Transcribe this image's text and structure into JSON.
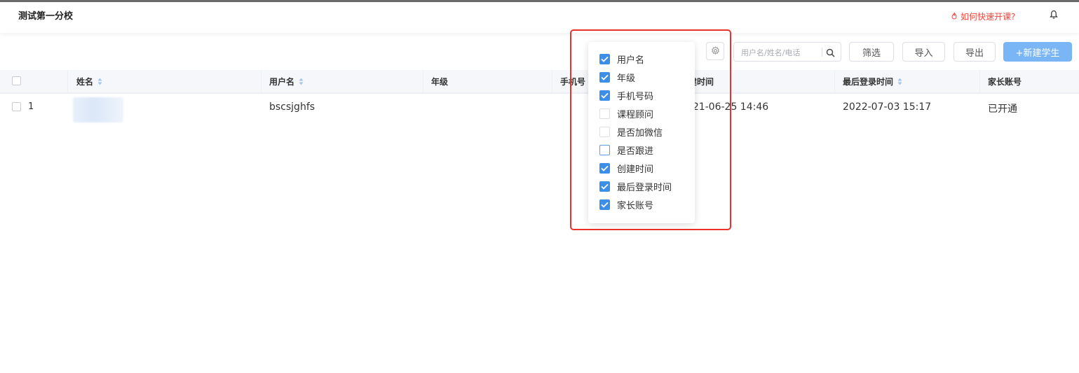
{
  "header": {
    "school_name": "测试第一分校",
    "help_link": "如何快速开课?"
  },
  "toolbar": {
    "search_placeholder": "用户名/姓名/电话",
    "filter_label": "筛选",
    "import_label": "导入",
    "export_label": "导出",
    "new_student_label": "+新建学生"
  },
  "table": {
    "columns": {
      "name": "姓名",
      "username": "用户名",
      "grade": "年级",
      "phone": "手机号",
      "created": "创建时间",
      "last_login": "最后登录时间",
      "parent_account": "家长账号"
    },
    "rows": [
      {
        "index": "1",
        "name": "",
        "username": "bscsjghfs",
        "grade": "",
        "created": "2021-06-25 14:46",
        "last_login": "2022-07-03 15:17",
        "parent_account": "已开通"
      }
    ]
  },
  "column_picker": {
    "items": [
      {
        "label": "用户名",
        "checked": true
      },
      {
        "label": "年级",
        "checked": true
      },
      {
        "label": "手机号码",
        "checked": true
      },
      {
        "label": "课程顾问",
        "checked": false
      },
      {
        "label": "是否加微信",
        "checked": false
      },
      {
        "label": "是否跟进",
        "checked": false
      },
      {
        "label": "创建时间",
        "checked": true
      },
      {
        "label": "最后登录时间",
        "checked": true
      },
      {
        "label": "家长账号",
        "checked": true
      }
    ]
  },
  "colors": {
    "accent": "#3c8fe8",
    "primary_button": "#7ab6f5",
    "help_link": "#f5453d",
    "highlight": "#e8322a"
  }
}
